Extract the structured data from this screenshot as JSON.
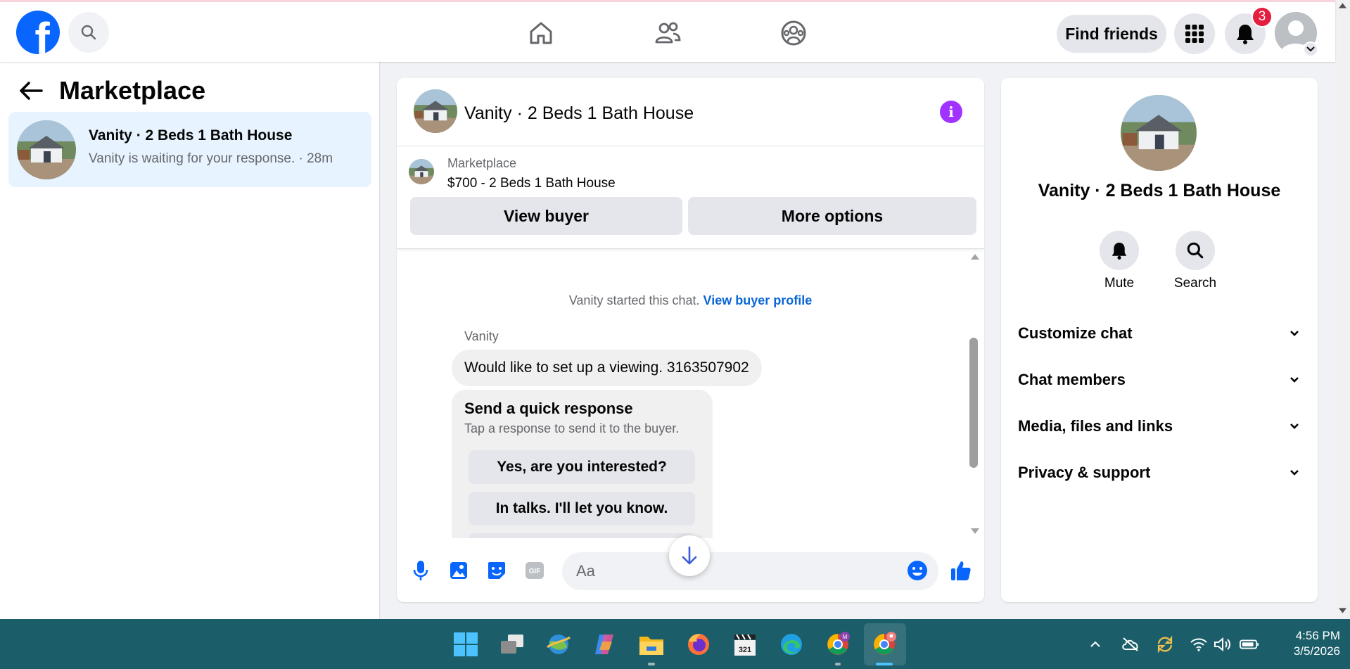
{
  "topbar": {
    "logo": "facebook-logo",
    "find_friends_label": "Find friends",
    "notification_count": "3"
  },
  "left_panel": {
    "title": "Marketplace",
    "conversation": {
      "name": "Vanity · 2 Beds 1 Bath House",
      "preview": "Vanity is waiting for your response. · 28m"
    }
  },
  "chat": {
    "title": "Vanity · 2 Beds 1 Bath House",
    "listing": {
      "source": "Marketplace",
      "title": "$700 - 2 Beds 1 Bath House",
      "view_buyer": "View buyer",
      "more_options": "More options"
    },
    "system_message": "Vanity started this chat.",
    "system_link": "View buyer profile",
    "sender": "Vanity",
    "message": "Would like to set up a viewing. 3163507902",
    "quick_response": {
      "title": "Send a quick response",
      "subtitle": "Tap a response to send it to the buyer.",
      "options": [
        "Yes, are you interested?",
        "In talks. I'll let you know."
      ]
    },
    "composer": {
      "placeholder": "Aa"
    }
  },
  "right_panel": {
    "name": "Vanity · 2 Beds 1 Bath House",
    "actions": [
      "Mute",
      "Search"
    ],
    "sections": [
      "Customize chat",
      "Chat members",
      "Media, files and links",
      "Privacy & support"
    ]
  },
  "taskbar": {
    "time": "4:56 PM",
    "date": "3/5/2026"
  },
  "colors": {
    "brand": "#0866ff",
    "accent_purple": "#a033ff",
    "badge_red": "#e41e3f",
    "taskbar": "#1b5e6a",
    "selected_conversation": "#e7f3ff"
  }
}
